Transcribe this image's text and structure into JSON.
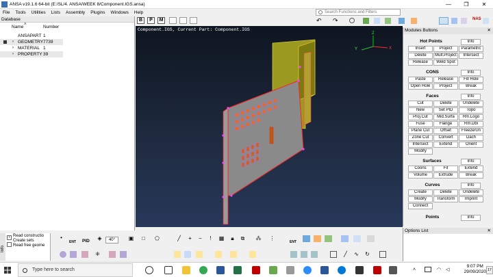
{
  "window": {
    "title": "ANSA v19.1.6 64-bit (E:/SL/4. ANSA/WEEK 8/Component.IGS.ansa)",
    "controls": [
      "—",
      "❐",
      "✕"
    ]
  },
  "menu": [
    "File",
    "Tools",
    "Utilities",
    "Lists",
    "Assembly",
    "Plugins",
    "Windows",
    "Help"
  ],
  "search": {
    "placeholder": "Search Functions and Filters"
  },
  "badges": {
    "nas": "NAS"
  },
  "toolbar_letters": [
    "B",
    "P",
    "M"
  ],
  "database": {
    "header": "Database",
    "col_name": "Name",
    "col_number": "Number",
    "rows": [
      {
        "name": "ANSAPART",
        "number": "1"
      },
      {
        "name": "GEOMETRY",
        "number": "7739"
      },
      {
        "name": "MATERIAL",
        "number": "1"
      },
      {
        "name": "PROPERTY",
        "number": "39"
      }
    ]
  },
  "viewport": {
    "status": "Component.IGS,  Current Part: Component.IGS",
    "axes": {
      "x": "X",
      "y": "Y",
      "z": "Z"
    }
  },
  "modules": {
    "header": "Modules Buttons",
    "sections": [
      {
        "title": "Hot Points",
        "buttons": [
          "Info",
          "Insert",
          "Project",
          "Parametric",
          "Delete",
          "Mult.Project",
          "Intersect",
          "Release",
          "Weld Spot"
        ]
      },
      {
        "title": "CONS",
        "buttons": [
          "Info",
          "Paste",
          "Release",
          "Fill Hole",
          "Open Hole",
          "Project",
          "Break"
        ]
      },
      {
        "title": "Faces",
        "buttons": [
          "Info",
          "Cut",
          "Delete",
          "Undelete",
          "New",
          "Set PID",
          "Topo",
          "Proj.Cut",
          "Mid.Surfa",
          "Rm.Logo",
          "Fuse",
          "Flange",
          "Rm.Dbl",
          "Plane Cut",
          "Offset",
          "Freeze/Un",
          "Zone Cut",
          "Convert",
          "Dach",
          "Intersect",
          "Extend",
          "Orient",
          "Modify"
        ]
      },
      {
        "title": "Surfaces",
        "buttons": [
          "Info",
          "Coons",
          "Fit",
          "Extend",
          "Volume",
          "Extrude",
          "Break"
        ]
      },
      {
        "title": "Curves",
        "buttons": [
          "Info",
          "Create",
          "Delete",
          "Undelete",
          "Modify",
          "Transform",
          "Imprint",
          "Connect"
        ]
      },
      {
        "title": "Points",
        "buttons": [
          "Info"
        ]
      }
    ]
  },
  "options": {
    "header": "Options List"
  },
  "info": {
    "tab": "Info",
    "lines": [
      "Read constructio",
      "Create sets",
      "Read free geome"
    ]
  },
  "bottom_toolbar": {
    "ent_label": "ENT",
    "pid_label": "PID",
    "angle": "40°"
  },
  "taskbar": {
    "search_placeholder": "Type here to search",
    "time": "9:07 PM",
    "date": "29/09/2020",
    "notif_count": "17"
  },
  "colors": {
    "accent": "#0078d7",
    "viewport_top": "#0e1520",
    "viewport_bottom": "#27385a",
    "part_plate": "#8a8a8a",
    "part_edges": "#ff2020",
    "part_back": "#9a9a20",
    "hotpoint_cons": "#ff40ff"
  }
}
